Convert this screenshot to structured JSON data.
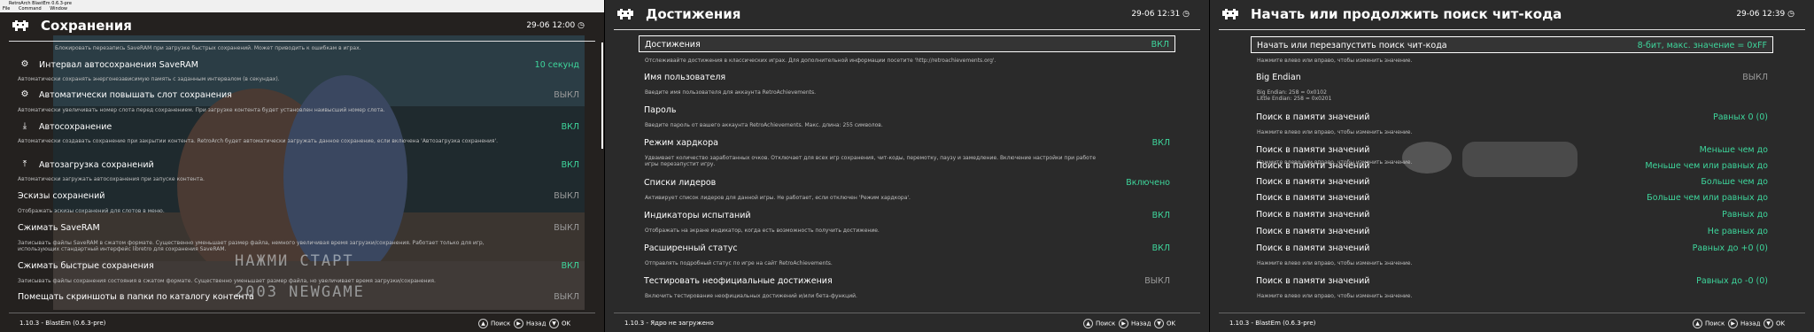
{
  "colors": {
    "enabled": "#3ed69c",
    "disabled": "#9a9a9a",
    "panel_bg": "#2a2a2a"
  },
  "p1": {
    "window_title": "RetroArch BlastEm 0.6.3-pre",
    "menu": [
      "File",
      "Command",
      "Window"
    ],
    "title": "Сохранения",
    "clock": "29-06 12:00",
    "top_desc": "Блокировать перезапись SaveRAM при загрузке быстрых сохранений. Может приводить к ошибкам в играх.",
    "items": [
      {
        "icon": "gear-icon",
        "glyph": "⚙",
        "label": "Интервал автосохранения SaveRAM",
        "value": "10 секунд",
        "state": "on",
        "desc": "Автоматически сохранять энергонезависимую память с заданным интервалом (в секундах)."
      },
      {
        "icon": "gear-icon",
        "glyph": "⚙",
        "label": "Автоматически повышать слот сохранения",
        "value": "ВЫКЛ",
        "state": "off",
        "desc": "Автоматически увеличивать номер слота перед сохранением. При загрузке контента будет установлен наивысший номер слота."
      },
      {
        "icon": "download-icon",
        "glyph": "↓",
        "label": "Автосохранение",
        "value": "ВКЛ",
        "state": "on",
        "desc": "Автоматически создавать сохранение при закрытии контента. RetroArch будет автоматически загружать данное сохранение, если включена 'Автозагрузка сохранения'."
      },
      {
        "icon": "upload-icon",
        "glyph": "↑",
        "label": "Автозагрузка сохранений",
        "value": "ВКЛ",
        "state": "on",
        "desc": "Автоматически загружать автосохранения при запуске контента."
      },
      {
        "icon": "",
        "glyph": "",
        "label": "Эскизы сохранений",
        "value": "ВЫКЛ",
        "state": "off",
        "desc": "Отображать эскизы сохранений для слотов в меню."
      },
      {
        "icon": "",
        "glyph": "",
        "label": "Сжимать SaveRAM",
        "value": "ВЫКЛ",
        "state": "off",
        "desc": "Записывать файлы SaveRAM в сжатом формате. Существенно уменьшает размер файла, немного увеличивая время загрузки/сохранения. Работает только для игр, использующих стандартный интерфейс libretro для сохранения SaveRAM."
      },
      {
        "icon": "",
        "glyph": "",
        "label": "Сжимать быстрые сохранения",
        "value": "ВКЛ",
        "state": "on",
        "desc": "Записывать файлы сохранения состояния в сжатом формате. Существенно уменьшает размер файла, но увеличивает время загрузки/сохранения."
      },
      {
        "icon": "",
        "glyph": "",
        "label": "Помещать скриншоты в папки по каталогу контента",
        "value": "ВЫКЛ",
        "state": "off",
        "desc": ""
      }
    ],
    "bg_text_1": "НАЖМИ СТАРТ",
    "bg_text_2": "2003 NEWGAME",
    "footer": {
      "version": "1.10.3 - BlastEm (0.6.3-pre)",
      "search": "Поиск",
      "back": "Назад",
      "ok": "OK"
    }
  },
  "p2": {
    "title": "Достижения",
    "clock": "29-06 12:31",
    "items": [
      {
        "label": "Достижения",
        "value": "ВКЛ",
        "state": "on",
        "selected": true,
        "desc": "Отслеживайте достижения в классических играх. Для дополнительной информации посетите 'http://retroachievements.org'."
      },
      {
        "label": "Имя пользователя",
        "value": "",
        "state": "",
        "desc": "Введите имя пользователя для аккаунта RetroAchievements."
      },
      {
        "label": "Пароль",
        "value": "",
        "state": "",
        "desc": "Введите пароль от вашего аккаунта RetroAchievements. Макс. длина: 255 символов."
      },
      {
        "label": "Режим хардкора",
        "value": "ВКЛ",
        "state": "on",
        "desc": "Удваивает количество заработанных очков. Отключает для всех игр сохранения, чит-коды, перемотку, паузу и замедление. Включение настройки при работе игры перезапустит игру."
      },
      {
        "label": "Списки лидеров",
        "value": "Включено",
        "state": "on",
        "desc": "Активирует список лидеров для данной игры. Не работает, если отключен 'Режим хардкора'."
      },
      {
        "label": "Индикаторы испытаний",
        "value": "ВКЛ",
        "state": "on",
        "desc": "Отображать на экране индикатор, когда есть возможность получить достижение."
      },
      {
        "label": "Расширенный статус",
        "value": "ВКЛ",
        "state": "on",
        "desc": "Отправлять подробный статус по игре на сайт RetroAchievements."
      },
      {
        "label": "Тестировать неофициальные достижения",
        "value": "ВЫКЛ",
        "state": "off",
        "desc": "Включить тестирование неофициальных достижений и/или бета-функций."
      }
    ],
    "footer": {
      "version": "1.10.3 - Ядро не загружено",
      "search": "Поиск",
      "back": "Назад",
      "ok": "OK"
    }
  },
  "p3": {
    "title": "Начать или продолжить поиск чит-кода",
    "clock": "29-06 12:39",
    "hint": "Нажмите влево или вправо, чтобы изменить значение.",
    "items": [
      {
        "label": "Начать или перезапустить поиск чит-кода",
        "value": "8-бит, макс. значение = 0xFF",
        "state": "on",
        "selected": true,
        "desc": "Нажмите влево или вправо, чтобы изменить значение."
      },
      {
        "label": "Big Endian",
        "value": "ВЫКЛ",
        "state": "off",
        "desc": "Big Endian: 258 = 0x0102\nLittle Endian: 258 = 0x0201"
      },
      {
        "label": "Поиск в памяти значений",
        "value": "Равных 0 (0)",
        "state": "on",
        "desc": "Нажмите влево или вправо, чтобы изменить значение."
      },
      {
        "label": "Поиск в памяти значений",
        "value": "Меньше чем до",
        "state": "on",
        "desc": "Нажмите влево или вправо, чтобы изменить значение."
      },
      {
        "label": "Поиск в памяти значений",
        "value": "Меньше чем или равных до",
        "state": "on",
        "desc": ""
      },
      {
        "label": "Поиск в памяти значений",
        "value": "Больше чем до",
        "state": "on",
        "desc": ""
      },
      {
        "label": "Поиск в памяти значений",
        "value": "Больше чем или равных до",
        "state": "on",
        "desc": ""
      },
      {
        "label": "Поиск в памяти значений",
        "value": "Равных до",
        "state": "on",
        "desc": ""
      },
      {
        "label": "Поиск в памяти значений",
        "value": "Не равных до",
        "state": "on",
        "desc": ""
      },
      {
        "label": "Поиск в памяти значений",
        "value": "Равных до +0 (0)",
        "state": "on",
        "desc": "Нажмите влево или вправо, чтобы изменить значение."
      },
      {
        "label": "Поиск в памяти значений",
        "value": "Равных до -0 (0)",
        "state": "on",
        "desc": "Нажмите влево или вправо, чтобы изменить значение."
      }
    ],
    "footer": {
      "version": "1.10.3 - BlastEm (0.6.3-pre)",
      "search": "Поиск",
      "back": "Назад",
      "ok": "OK"
    }
  }
}
